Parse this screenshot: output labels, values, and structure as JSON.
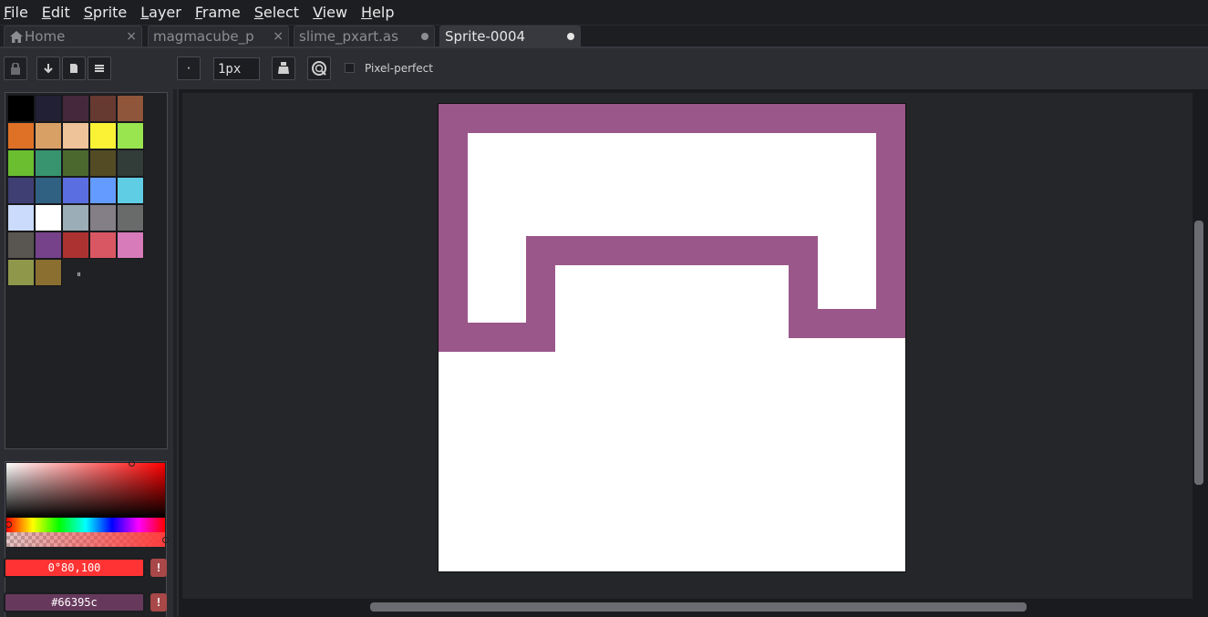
{
  "menu": {
    "items": [
      {
        "u": "F",
        "rest": "ile"
      },
      {
        "u": "E",
        "rest": "dit"
      },
      {
        "u": "S",
        "rest": "prite"
      },
      {
        "u": "L",
        "rest": "ayer"
      },
      {
        "u": "F",
        "rest": "rame"
      },
      {
        "u": "S",
        "rest": "elect"
      },
      {
        "u": "V",
        "rest": "iew"
      },
      {
        "u": "H",
        "rest": "elp"
      }
    ]
  },
  "tabs": [
    {
      "label": "Home",
      "icon": "home-icon",
      "close": "×"
    },
    {
      "label": "magmacube_p",
      "close": "×"
    },
    {
      "label": "slime_pxart.as",
      "modified": true
    },
    {
      "label": "Sprite-0004",
      "modified": true,
      "active": true
    }
  ],
  "toolbar": {
    "brush_shape": "·",
    "brush_size": "1px",
    "pixel_perfect_label": "Pixel-perfect",
    "pixel_perfect_checked": false
  },
  "palette": {
    "colors": [
      "#000000",
      "#222034",
      "#45283c",
      "#663931",
      "#8f563b",
      "#df7126",
      "#d9a066",
      "#eec39a",
      "#fbf236",
      "#99e550",
      "#6abe30",
      "#37946e",
      "#4b692f",
      "#524b24",
      "#323c39",
      "#3f3f74",
      "#306082",
      "#5b6ee1",
      "#639bff",
      "#5fcde4",
      "#cbdbfc",
      "#ffffff",
      "#9badb7",
      "#847e87",
      "#696a6a",
      "#595652",
      "#76428a",
      "#ac3232",
      "#d95763",
      "#d77bba",
      "#8f974a",
      "#8a6f30"
    ],
    "grip": "⏸"
  },
  "colors": {
    "foreground_value": "0°80,100",
    "foreground_hex": "#ff3333",
    "background_value": "#66395c",
    "background_hex": "#66395c",
    "warn_label": "!"
  },
  "sprite": {
    "stroke_color": "#9a578a",
    "background": "#ffffff"
  }
}
